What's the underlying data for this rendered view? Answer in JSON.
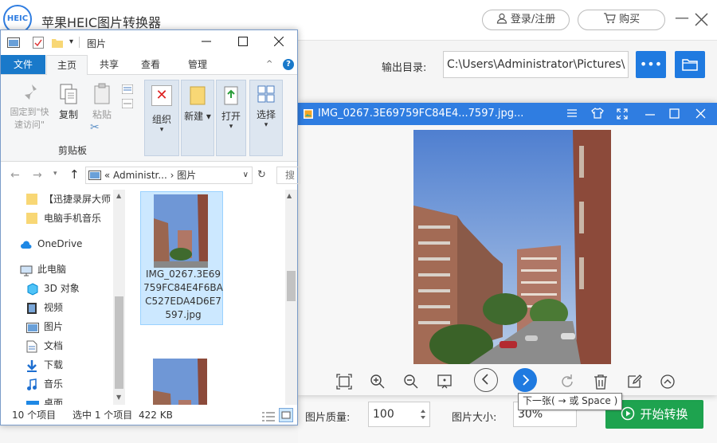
{
  "app": {
    "logo_text": "HEIC",
    "title": "苹果HEIC图片转换器",
    "login_label": "登录/注册",
    "buy_label": "购买",
    "output_label": "输出目录:",
    "output_path": "C:\\Users\\Administrator\\Pictures\\",
    "more_label": "•••",
    "quality_label": "图片质量:",
    "quality_value": "100",
    "size_label": "图片大小:",
    "size_value": "30%",
    "start_label": "开始转换",
    "accent": "#1f7ae0",
    "start_color": "#1ea34f"
  },
  "explorer": {
    "title": "图片",
    "tabs": [
      "文件",
      "主页",
      "共享",
      "查看",
      "管理"
    ],
    "ribbon": {
      "pin_label": "固定到\"快速访问\"",
      "copy_label": "复制",
      "paste_label": "粘贴",
      "clipboard_label": "剪贴板",
      "organize_label": "组织",
      "new_label": "新建",
      "open_label": "打开",
      "select_label": "选择"
    },
    "address": [
      "«",
      "Administr...",
      "›",
      "图片"
    ],
    "search_placeholder": "搜索",
    "tree": [
      {
        "label": "【迅捷录屏大师",
        "icon": "folder-icon"
      },
      {
        "label": "电脑手机音乐",
        "icon": "folder-icon"
      },
      {
        "label": "OneDrive",
        "icon": "cloud-icon"
      },
      {
        "label": "此电脑",
        "icon": "computer-icon"
      },
      {
        "label": "3D 对象",
        "icon": "cube-icon"
      },
      {
        "label": "视频",
        "icon": "video-icon"
      },
      {
        "label": "图片",
        "icon": "picture-icon"
      },
      {
        "label": "文档",
        "icon": "document-icon"
      },
      {
        "label": "下载",
        "icon": "download-icon"
      },
      {
        "label": "音乐",
        "icon": "music-icon"
      },
      {
        "label": "桌面",
        "icon": "desktop-icon"
      }
    ],
    "selected_file": "IMG_0267.3E69759FC84E4F6BAC527EDA4D6E7597.jpg",
    "status_count": "10 个项目",
    "status_selected": "选中 1 个项目",
    "status_size": "422 KB"
  },
  "viewer": {
    "title": "IMG_0267.3E69759FC84E4...7597.jpg...",
    "tooltip": "下一张( → 或 Space )"
  }
}
